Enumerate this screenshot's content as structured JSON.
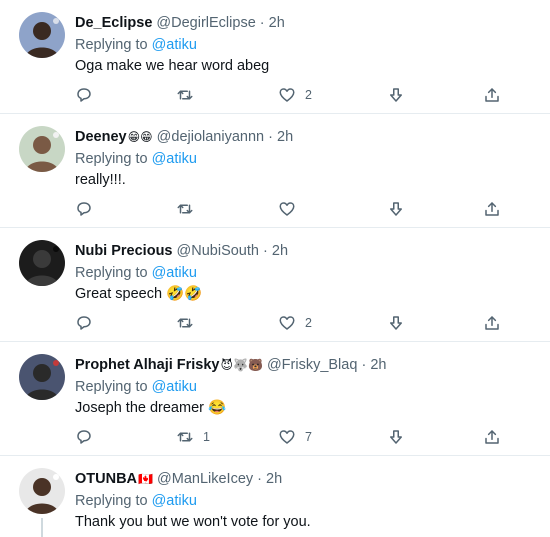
{
  "tweets": [
    {
      "name": "De_Eclipse",
      "name_emoji": "",
      "handle": "@DegirlEclipse",
      "time": "2h",
      "reply_prefix": "Replying to",
      "reply_to": "@atiku",
      "text": "Oga make we hear word abeg",
      "replies": "",
      "retweets": "",
      "likes": "2",
      "avatar": {
        "bg": "#8ea3c9",
        "face": "#3a2a22",
        "accent": "#d9dfea"
      }
    },
    {
      "name": "Deeney",
      "name_emoji": "😁😁",
      "handle": "@dejiolaniyannn",
      "time": "2h",
      "reply_prefix": "Replying to",
      "reply_to": "@atiku",
      "text": "really!!!.",
      "replies": "",
      "retweets": "",
      "likes": "",
      "avatar": {
        "bg": "#c8d7c5",
        "face": "#7a5a45",
        "accent": "#f2f2f2"
      }
    },
    {
      "name": "Nubi Precious",
      "name_emoji": "",
      "handle": "@NubiSouth",
      "time": "2h",
      "reply_prefix": "Replying to",
      "reply_to": "@atiku",
      "text": "Great speech 🤣🤣",
      "replies": "",
      "retweets": "",
      "likes": "2",
      "avatar": {
        "bg": "#1c1c1c",
        "face": "#3a3a3a",
        "accent": "#0a0a0a"
      }
    },
    {
      "name": "Prophet Alhaji Frisky",
      "name_emoji": "😈🐺🐻",
      "handle": "@Frisky_Blaq",
      "time": "2h",
      "reply_prefix": "Replying to",
      "reply_to": "@atiku",
      "text": "Joseph the dreamer 😂",
      "replies": "",
      "retweets": "1",
      "likes": "7",
      "avatar": {
        "bg": "#4a5470",
        "face": "#2a2a2a",
        "accent": "#c23a3a"
      }
    },
    {
      "name": "OTUNBA",
      "name_emoji": "🇨🇦",
      "handle": "@ManLikeIcey",
      "time": "2h",
      "reply_prefix": "Replying to",
      "reply_to": "@atiku",
      "text": "Thank you but we won't vote for you.",
      "replies": "",
      "retweets": "",
      "likes": "",
      "avatar": {
        "bg": "#e8e8e8",
        "face": "#4a3326",
        "accent": "#ffffff"
      }
    }
  ],
  "icons": {
    "reply": "reply-icon",
    "retweet": "retweet-icon",
    "like": "heart-icon",
    "downvote": "downvote-icon",
    "share": "share-icon"
  },
  "colors": {
    "text": "#0f1419",
    "secondary": "#536471",
    "link": "#1d9bf0",
    "divider": "#e6ecf0"
  }
}
